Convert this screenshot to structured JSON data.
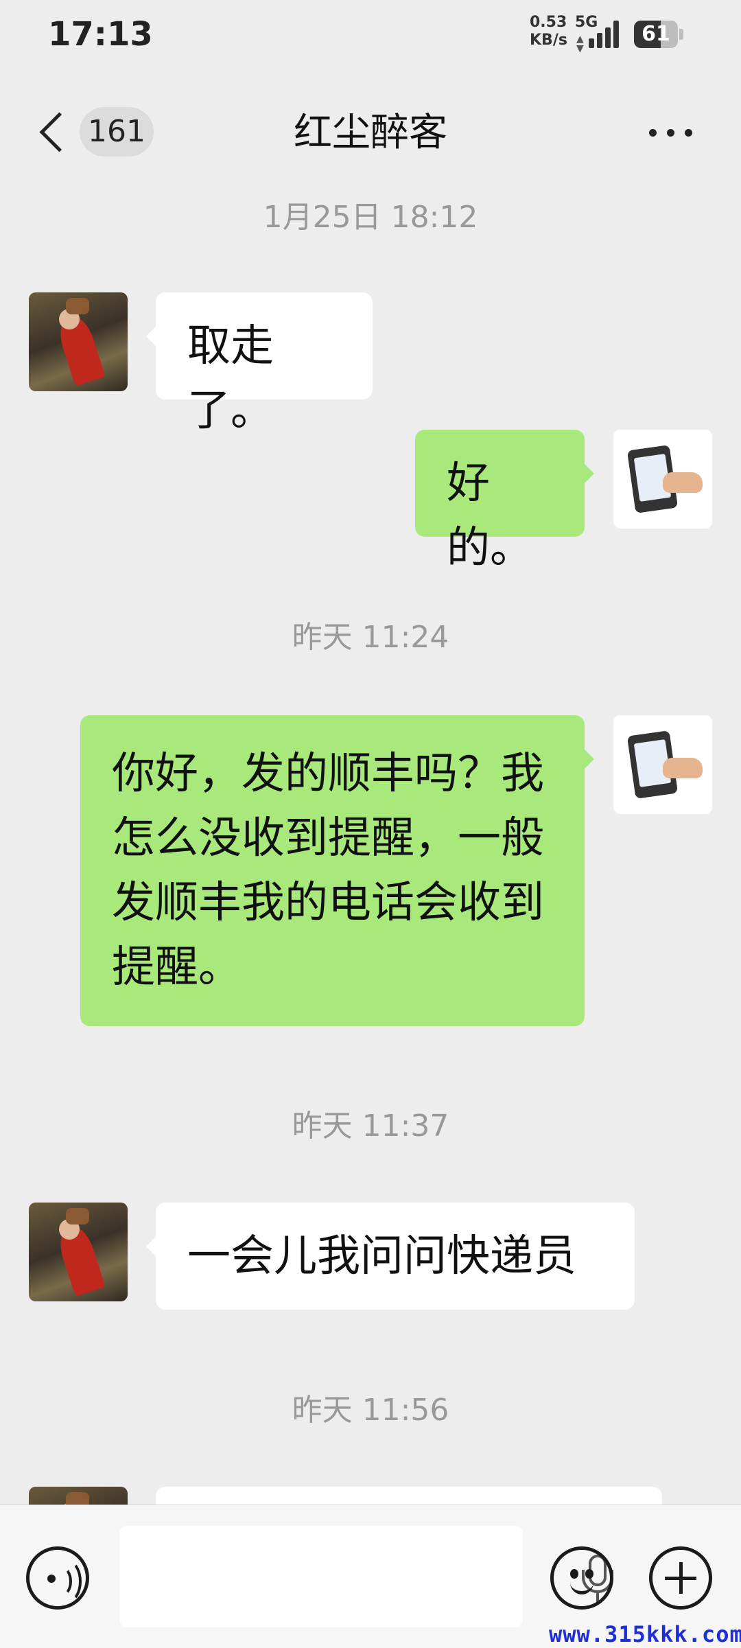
{
  "status_bar": {
    "time": "17:13",
    "net_speed": "0.53",
    "net_unit": "KB/s",
    "network": "5G",
    "battery": "61",
    "battery_level": 0.61
  },
  "header": {
    "unread_count": "161",
    "title": "红尘醉客",
    "back_icon": "chevron-left-icon",
    "more_icon": "more-dots-icon"
  },
  "messages": [
    {
      "type": "timestamp",
      "text": "1月25日 18:12"
    },
    {
      "type": "message",
      "sender": "other",
      "text": "取走了。"
    },
    {
      "type": "message",
      "sender": "self",
      "text": "好的。"
    },
    {
      "type": "timestamp",
      "text": "昨天 11:24"
    },
    {
      "type": "message",
      "sender": "self",
      "text": "你好，发的顺丰吗？我怎么没收到提醒，一般发顺丰我的电话会收到提醒。"
    },
    {
      "type": "timestamp",
      "text": "昨天 11:37"
    },
    {
      "type": "message",
      "sender": "other",
      "text": "一会儿我问问快递员"
    },
    {
      "type": "timestamp",
      "text": "昨天 11:56"
    }
  ],
  "input_bar": {
    "voice_icon": "voice-mode-icon",
    "mic_icon": "microphone-icon",
    "emoji_icon": "emoji-icon",
    "plus_icon": "plus-icon"
  },
  "watermark": "www.315kkk.com",
  "colors": {
    "background": "#ededed",
    "self_bubble": "#a9e97c",
    "other_bubble": "#ffffff",
    "timestamp": "#999999"
  }
}
